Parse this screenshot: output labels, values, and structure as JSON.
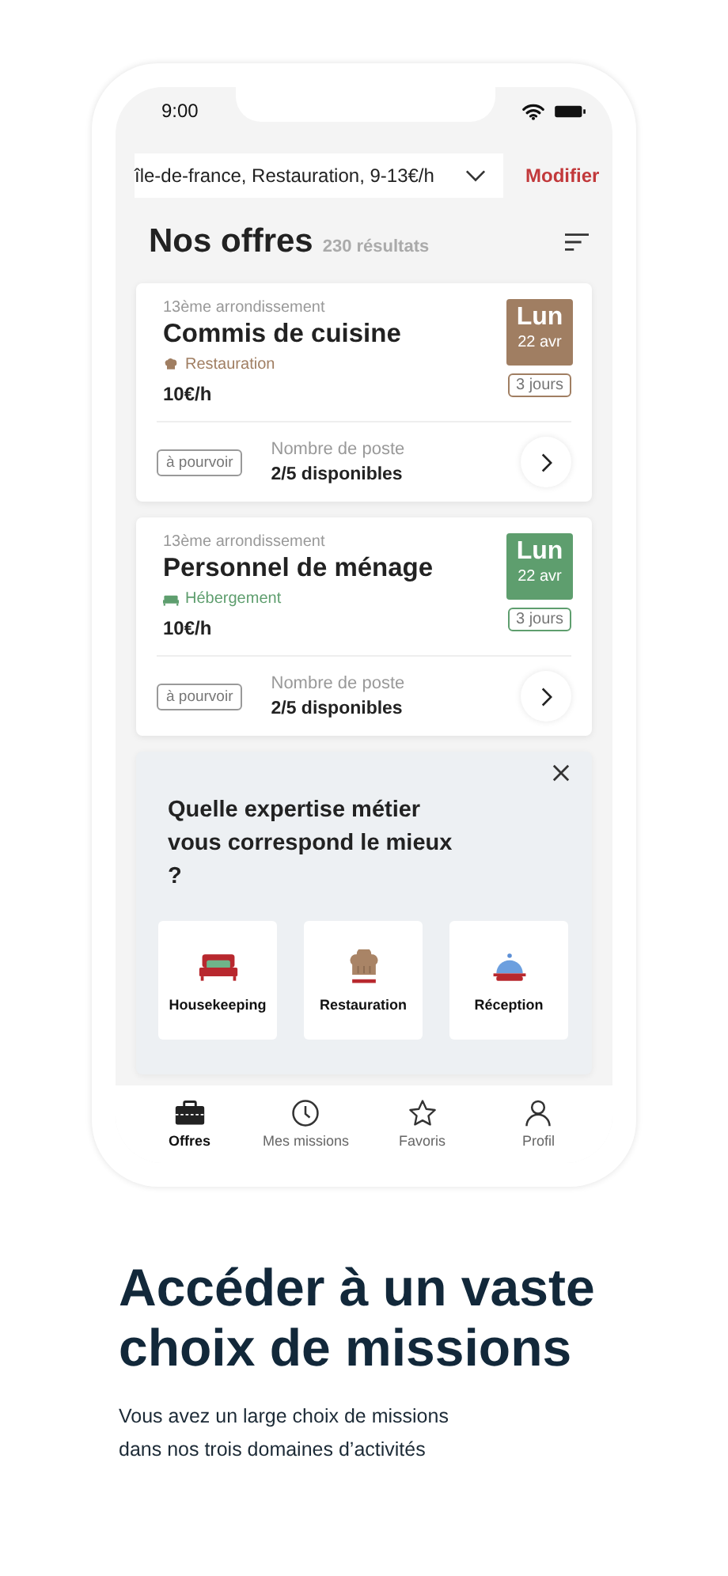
{
  "status_bar": {
    "time": "9:00"
  },
  "filter": {
    "value": "île-de-france, Restauration, 9-13€/h",
    "action": "Modifier"
  },
  "header": {
    "title": "Nos offres",
    "count": "230 résultats"
  },
  "offers": [
    {
      "district": "13ème arrondissement",
      "title": "Commis de cuisine",
      "category": "Restauration",
      "color": "#a07e62",
      "rate": "10€/h",
      "day": "Lun",
      "date": "22 avr",
      "duration": "3 jours",
      "status": "à pourvoir",
      "positions_label": "Nombre de poste",
      "positions": "2/5 disponibles"
    },
    {
      "district": "13ème arrondissement",
      "title": "Personnel de ménage",
      "category": "Hébergement",
      "color": "#5e9e6e",
      "rate": "10€/h",
      "day": "Lun",
      "date": "22 avr",
      "duration": "3 jours",
      "status": "à pourvoir",
      "positions_label": "Nombre de poste",
      "positions": "2/5 disponibles"
    }
  ],
  "expertise": {
    "title": "Quelle expertise métier vous correspond le mieux ?",
    "options": [
      {
        "label": "Housekeeping"
      },
      {
        "label": "Restauration"
      },
      {
        "label": "Réception"
      }
    ]
  },
  "tabs": [
    {
      "label": "Offres",
      "selected": true
    },
    {
      "label": "Mes missions",
      "selected": false
    },
    {
      "label": "Favoris",
      "selected": false
    },
    {
      "label": "Profil",
      "selected": false
    }
  ],
  "promo": {
    "headline": "Accéder à un vaste choix de missions",
    "text": "Vous avez un large choix de missions dans nos trois domaines d’activités"
  }
}
